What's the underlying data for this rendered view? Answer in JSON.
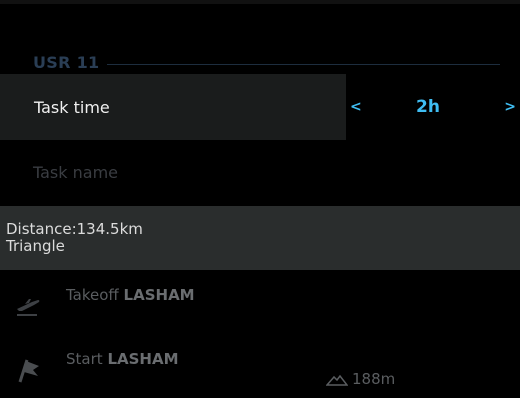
{
  "section": {
    "title": "USR 11"
  },
  "task_time": {
    "label": "Task time",
    "prev_symbol": "<",
    "value": "2h",
    "next_symbol": ">"
  },
  "task_name": {
    "placeholder": "Task name"
  },
  "summary": {
    "distance": "Distance:134.5km",
    "type": "Triangle"
  },
  "waypoints": [
    {
      "icon": "takeoff-plane-icon",
      "type": "Takeoff",
      "name": "LASHAM",
      "elevation": ""
    },
    {
      "icon": "start-flag-icon",
      "type": "Start",
      "name": "LASHAM",
      "elevation": "188m"
    }
  ],
  "colors": {
    "accent": "#3fbdf2",
    "section": "#2a3e55",
    "summary_bg": "#2a2d2d",
    "row_bg": "#1a1c1c"
  }
}
